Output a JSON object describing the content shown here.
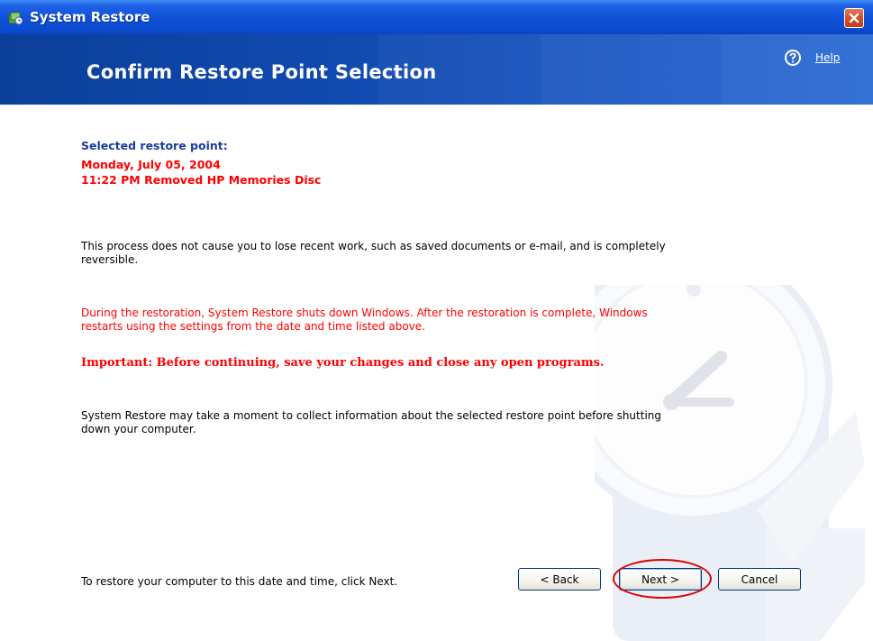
{
  "window": {
    "title": "System Restore",
    "close_label": "×"
  },
  "banner": {
    "title": "Confirm Restore Point Selection",
    "help_label": "Help"
  },
  "content": {
    "selected_label": "Selected restore point:",
    "restore_point_date": "Monday, July 05, 2004",
    "restore_point_desc": "11:22 PM Removed HP Memories Disc",
    "paragraph1": "This process does not cause you to lose recent work, such as saved documents or e-mail, and is completely reversible.",
    "paragraph2": "During the restoration, System Restore shuts down Windows. After the restoration is complete, Windows restarts using the settings from the date and time listed above.",
    "important": "Important: Before continuing, save your changes and close any open programs.",
    "paragraph4": "System Restore may take a moment to collect information about the selected restore point before shutting down your computer.",
    "footer_instruction": "To restore your computer to this date and time, click Next."
  },
  "buttons": {
    "back": "< Back",
    "next": "Next >",
    "cancel": "Cancel"
  },
  "icons": {
    "app": "system-restore-icon",
    "help": "help-icon",
    "close": "close-icon",
    "watermark": "clock-watermark-icon"
  },
  "colors": {
    "title_bar": "#0b4cd0",
    "banner": "#114ab0",
    "heading_blue": "#1b3b9e",
    "warning_red": "#ff0000",
    "highlight": "#e00000"
  }
}
